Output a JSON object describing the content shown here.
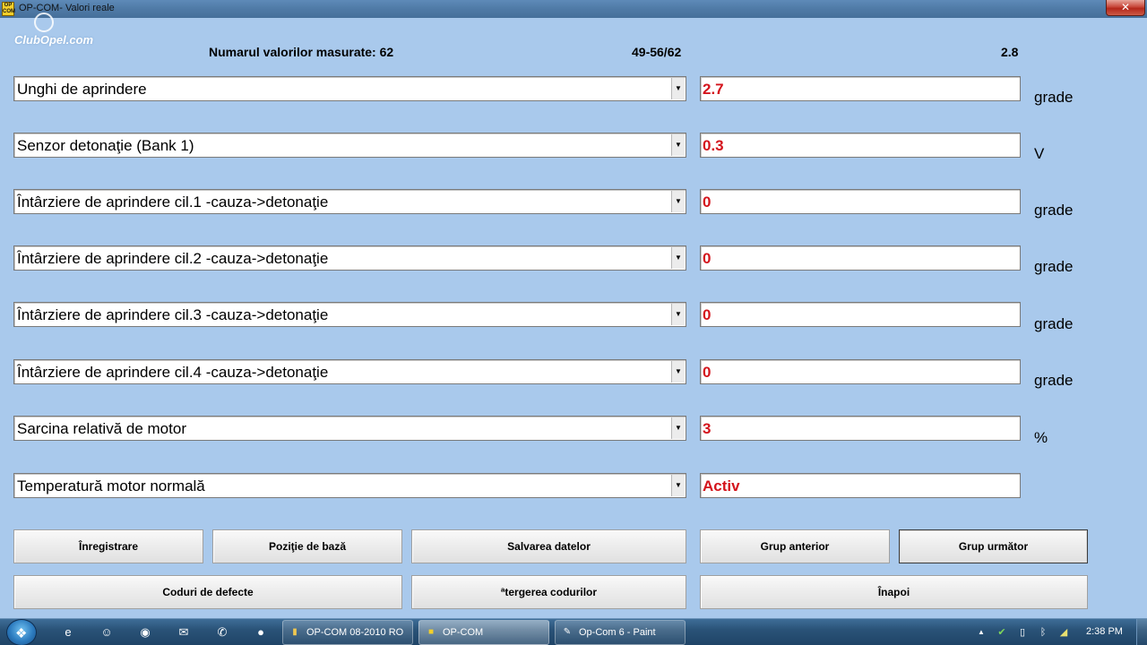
{
  "window": {
    "title": "OP-COM- Valori reale",
    "app_icon_text": "OP COM",
    "close_glyph": "✕"
  },
  "logo": {
    "text": "ClubOpel.com"
  },
  "header": {
    "count_label": "Numarul valorilor masurate: 62",
    "range": "49-56/62",
    "version": "2.8"
  },
  "rows": [
    {
      "parameter": "Unghi de aprindere",
      "value": "2.7",
      "unit": "grade"
    },
    {
      "parameter": "Senzor detonaţie (Bank 1)",
      "value": "0.3",
      "unit": "V"
    },
    {
      "parameter": "Întârziere de aprindere cil.1 -cauza->detonaţie",
      "value": "0",
      "unit": "grade"
    },
    {
      "parameter": "Întârziere de aprindere cil.2 -cauza->detonaţie",
      "value": "0",
      "unit": "grade"
    },
    {
      "parameter": "Întârziere de aprindere cil.3 -cauza->detonaţie",
      "value": "0",
      "unit": "grade"
    },
    {
      "parameter": "Întârziere de aprindere cil.4 -cauza->detonaţie",
      "value": "0",
      "unit": "grade"
    },
    {
      "parameter": "Sarcina relativă de motor",
      "value": "3",
      "unit": "%"
    },
    {
      "parameter": "Temperatură  motor normală",
      "value": "Activ",
      "unit": ""
    }
  ],
  "dropdown_arrow": "▼",
  "buttons": {
    "record": "Înregistrare",
    "base_position": "Poziţie de bază",
    "save_data": "Salvarea datelor",
    "prev_group": "Grup anterior",
    "next_group": "Grup următor",
    "fault_codes": "Coduri de defecte",
    "clear_codes": "ªtergerea codurilor",
    "back": "Înapoi"
  },
  "colors": {
    "background": "#a9c9ec",
    "value_text": "#d4141c"
  },
  "taskbar": {
    "start_icon": "windows-logo-icon",
    "pinned": [
      {
        "icon": "internet-explorer-icon",
        "glyph": "e"
      },
      {
        "icon": "messenger-icon",
        "glyph": "☺"
      },
      {
        "icon": "chrome-icon",
        "glyph": "◉"
      },
      {
        "icon": "chat-icon",
        "glyph": "✉"
      },
      {
        "icon": "viber-icon",
        "glyph": "✆"
      },
      {
        "icon": "firefox-icon",
        "glyph": "●"
      }
    ],
    "tasks": [
      {
        "label": "OP-COM 08-2010 RO",
        "icon": "folder-icon",
        "glyph": "▮"
      },
      {
        "label": "OP-COM",
        "icon": "opcom-icon",
        "glyph": "■"
      },
      {
        "label": "Op-Com 6 - Paint",
        "icon": "paint-icon",
        "glyph": "✎"
      }
    ],
    "tray": [
      {
        "icon": "show-hidden-icons",
        "glyph": "▲"
      },
      {
        "icon": "network-icon",
        "glyph": "✔"
      },
      {
        "icon": "battery-icon",
        "glyph": "▯"
      },
      {
        "icon": "bluetooth-icon",
        "glyph": "ᛒ"
      },
      {
        "icon": "wifi-icon",
        "glyph": "◢"
      },
      {
        "icon": "volume-icon",
        "glyph": "◀"
      }
    ],
    "clock": "2:38 PM"
  }
}
